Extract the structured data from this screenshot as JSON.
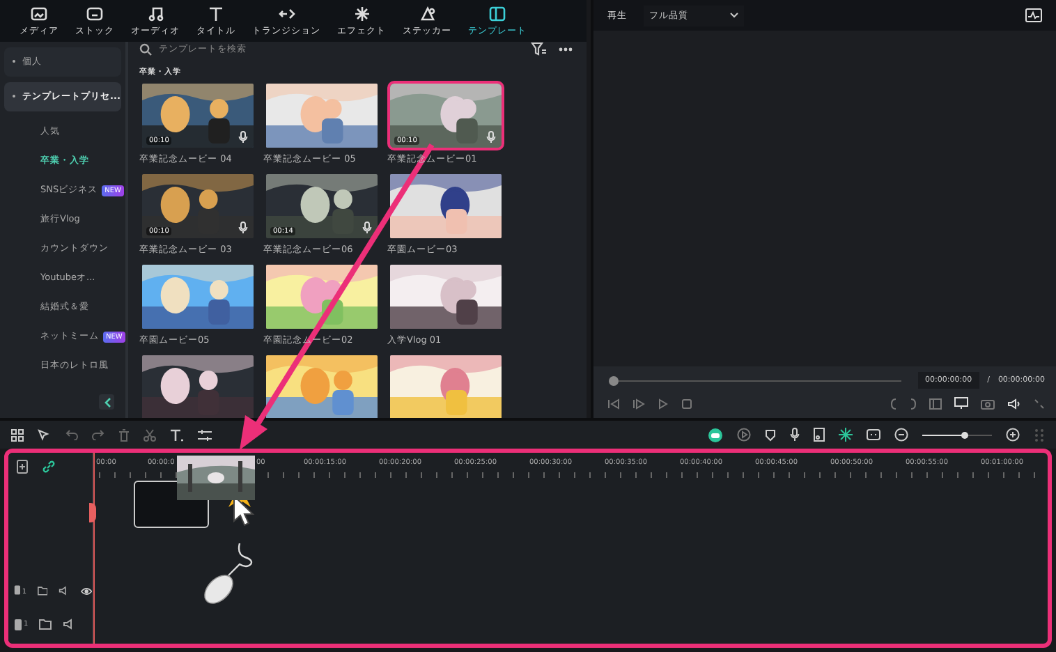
{
  "toolbar": {
    "tabs": [
      {
        "label": "メディア",
        "selected": false
      },
      {
        "label": "ストック",
        "selected": false
      },
      {
        "label": "オーディオ",
        "selected": false
      },
      {
        "label": "タイトル",
        "selected": false
      },
      {
        "label": "トランジション",
        "selected": false
      },
      {
        "label": "エフェクト",
        "selected": false
      },
      {
        "label": "ステッカー",
        "selected": false
      },
      {
        "label": "テンプレート",
        "selected": true
      }
    ]
  },
  "sidebar": {
    "groups": [
      {
        "label": "個人",
        "selected": false
      },
      {
        "label": "テンプレートプリセ...",
        "selected": true,
        "children": [
          {
            "label": "人気",
            "selected": false
          },
          {
            "label": "卒業・入学",
            "selected": true
          },
          {
            "label": "SNSビジネス",
            "selected": false,
            "badge": "NEW"
          },
          {
            "label": "旅行Vlog",
            "selected": false
          },
          {
            "label": "カウントダウン",
            "selected": false
          },
          {
            "label": "Youtubeオ...",
            "selected": false
          },
          {
            "label": "結婚式＆愛",
            "selected": false
          },
          {
            "label": "ネットミーム",
            "selected": false,
            "badge": "NEW"
          },
          {
            "label": "日本のレトロ風",
            "selected": false
          }
        ]
      }
    ]
  },
  "library": {
    "search": {
      "placeholder": "テンプレートを検索"
    },
    "section_title": "卒業・入学",
    "templates": [
      {
        "name": "卒業記念ムービー 04",
        "duration": "00:10",
        "selected": false
      },
      {
        "name": "卒業記念ムービー 05",
        "selected": false
      },
      {
        "name": "卒業記念ムービー01",
        "duration": "00:10",
        "selected": true
      },
      {
        "name": "卒業記念ムービー 03",
        "duration": "00:10",
        "selected": false
      },
      {
        "name": "卒業記念ムービー06",
        "duration": "00:14",
        "selected": false
      },
      {
        "name": "卒園ムービー03",
        "selected": false
      },
      {
        "name": "卒園ムービー05",
        "selected": false
      },
      {
        "name": "卒園記念ムービー02",
        "selected": false
      },
      {
        "name": "入学Vlog 01",
        "selected": false
      },
      {
        "selected": false
      },
      {
        "selected": false
      },
      {
        "selected": false
      }
    ]
  },
  "preview": {
    "label": "再生",
    "quality": "フル品質",
    "progress": {
      "level": 0
    },
    "current_time": "00:00:00:00",
    "separator": "/",
    "total_time": "00:00:00:00"
  },
  "timeline": {
    "zoom": {
      "level": 0.6
    },
    "ruler": [
      "00:00",
      "00:00:0",
      "00",
      "00:00:15:00",
      "00:00:20:00",
      "00:00:25:00",
      "00:00:30:00",
      "00:00:35:00",
      "00:00:40:00",
      "00:00:45:00",
      "00:00:50:00",
      "00:00:55:00",
      "00:01:00:00"
    ],
    "tracks": [
      {
        "kind": "video",
        "number": "1"
      },
      {
        "kind": "audio",
        "number": "1"
      }
    ]
  }
}
